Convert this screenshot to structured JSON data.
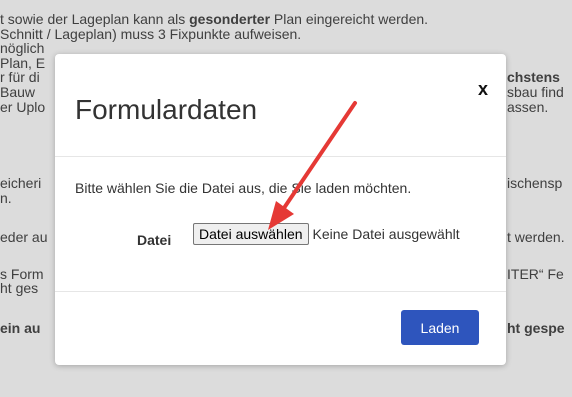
{
  "background": {
    "lines": [
      {
        "pre": "t sowie der Lageplan kann als ",
        "bold": "gesonderter",
        "post": " Plan eingereicht werden."
      },
      {
        "pre": "Schnitt / Lageplan) muss 3 Fixpunkte aufweisen.",
        "bold": "",
        "post": ""
      },
      {
        "pre": "nöglich",
        "bold": "",
        "post": ""
      },
      {
        "pre": "Plan, E",
        "bold": "",
        "post": ""
      },
      {
        "pre": "r für di",
        "bold": "",
        "post": ""
      },
      {
        "pre": " Bauw",
        "bold": "",
        "post": ""
      },
      {
        "pre": "er Uplo",
        "bold": "",
        "post": ""
      },
      {
        "pre": "eicheri",
        "bold": "",
        "post": ""
      },
      {
        "pre": "n.",
        "bold": "",
        "post": ""
      },
      {
        "pre": "eder au",
        "bold": "",
        "post": ""
      },
      {
        "pre": "s Form",
        "bold": "",
        "post": ""
      },
      {
        "pre": "ht ges",
        "bold": "",
        "post": ""
      },
      {
        "pre": "",
        "bold": "ein au",
        "post": ""
      }
    ],
    "right_lines": [
      {
        "pre": "",
        "bold": "chstens",
        "post": ""
      },
      {
        "pre": "sbau find",
        "bold": "",
        "post": ""
      },
      {
        "pre": "assen.",
        "bold": "",
        "post": ""
      },
      {
        "pre": "ischensp",
        "bold": "",
        "post": ""
      },
      {
        "pre": "t werden.",
        "bold": "",
        "post": ""
      },
      {
        "pre": "ITER“ Fe",
        "bold": "",
        "post": ""
      },
      {
        "pre": "",
        "bold": "ht gespe",
        "post": ""
      }
    ]
  },
  "modal": {
    "title": "Formulardaten",
    "close_label": "x",
    "instruction": "Bitte wählen Sie die Datei aus, die Sie laden möchten.",
    "file_label": "Datei",
    "file_button_label": "Datei auswählen",
    "file_status": "Keine Datei ausgewählt",
    "submit_label": "Laden"
  },
  "annotation": {
    "arrow_color": "#e53935"
  },
  "colors": {
    "primary_button": "#2e55bd",
    "backdrop": "#dcdcdc"
  }
}
